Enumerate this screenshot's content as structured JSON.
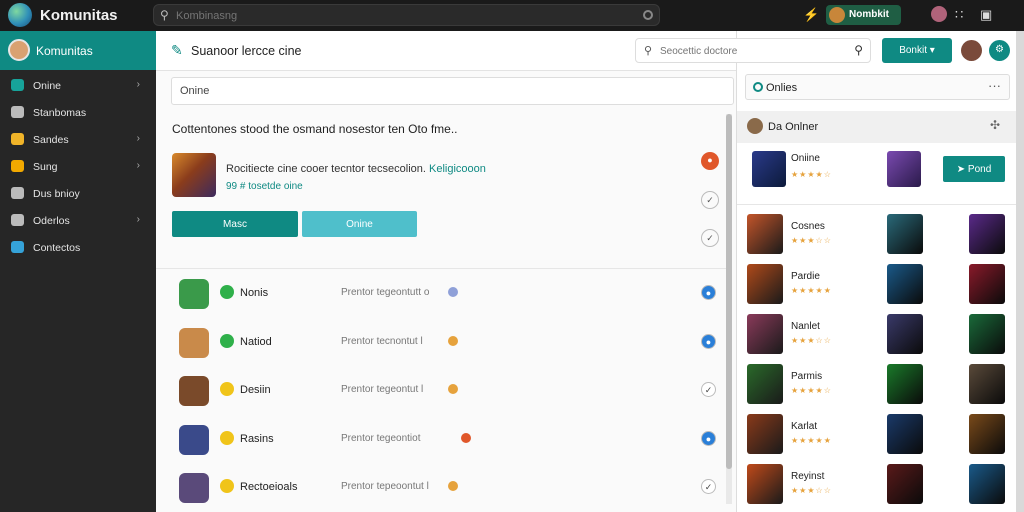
{
  "app": {
    "title": "Komunitas"
  },
  "top_search": {
    "placeholder": "Kombinasng"
  },
  "top_right": {
    "pill_label": "Nombkit"
  },
  "sidebar": {
    "header": "Komunitas",
    "items": [
      {
        "label": "Onine",
        "icon": "home-icon",
        "color": "#17a39a",
        "chevron": true
      },
      {
        "label": "Stanbomas",
        "icon": "chat-icon",
        "color": "#bbbbbb",
        "chevron": false
      },
      {
        "label": "Sandes",
        "icon": "bolt-icon",
        "color": "#f0b429",
        "chevron": true
      },
      {
        "label": "Sung",
        "icon": "star-icon",
        "color": "#f2a900",
        "chevron": true
      },
      {
        "label": "Dus bnioy",
        "icon": "pencil-icon",
        "color": "#bbbbbb",
        "chevron": false
      },
      {
        "label": "Oderlos",
        "icon": "gear-icon",
        "color": "#bbbbbb",
        "chevron": true
      },
      {
        "label": "Contectos",
        "icon": "network-icon",
        "color": "#35a2d8",
        "chevron": false
      }
    ]
  },
  "main": {
    "header_title": "Suanoor lercce cine",
    "tab_label": "Onine",
    "post": {
      "title": "Cottentones stood  the osmand nosestor ten Oto fme..",
      "desc": "Rocitiecte cine cooer tecntor tecsecolion.",
      "desc_link": "Keligicooon",
      "meta": "99 # tosetde oine",
      "primary_btn": "Masc",
      "secondary_btn": "Onine"
    },
    "rows": [
      {
        "name": "Nonis",
        "desc": "Prentor tegeontutt o",
        "tag_color": "#8fa0d8",
        "thumb": "#3a9a4a",
        "emo": "#2fb04a"
      },
      {
        "name": "Natiod",
        "desc": "Prentor tecnontut l",
        "tag_color": "#e6a23c",
        "thumb": "#c98a4a",
        "emo": "#2fb04a"
      },
      {
        "name": "Desiin",
        "desc": "Prentor tegeontut l",
        "tag_color": "#e6a23c",
        "thumb": "#7a4a2a",
        "emo": "#f0c419"
      },
      {
        "name": "Rasins",
        "desc": "Prentor tegeontiot",
        "tag_color": "#e0572a",
        "thumb": "#3a4a8a",
        "emo": "#f0c419"
      },
      {
        "name": "Rectoeioals",
        "desc": "Prentor tepeoontut l",
        "tag_color": "#e6a23c",
        "thumb": "#5a4a7a",
        "emo": "#f0c419"
      }
    ]
  },
  "right": {
    "search_placeholder": "Seocettic doctore",
    "top_button": "Bonkit",
    "online_label": "Onlies",
    "section_label": "Da Onlner",
    "featured": {
      "name": "Oniine",
      "rating": 4,
      "button": "Pond"
    },
    "games": [
      {
        "name": "Cosnes",
        "rating": 3
      },
      {
        "name": "Pardie",
        "rating": 5
      },
      {
        "name": "Nanlet",
        "rating": 3
      },
      {
        "name": "Parmis",
        "rating": 4
      },
      {
        "name": "Karlat",
        "rating": 5
      },
      {
        "name": "Reyinst",
        "rating": 3
      }
    ]
  }
}
